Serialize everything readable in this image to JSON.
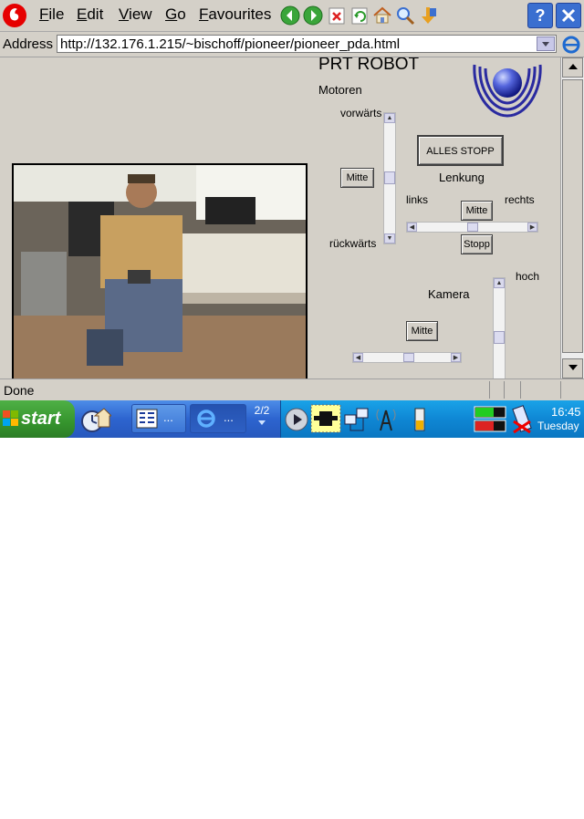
{
  "menubar": {
    "items": [
      {
        "key": "F",
        "rest": "ile"
      },
      {
        "key": "E",
        "rest": "dit"
      },
      {
        "key": "V",
        "rest": "iew"
      },
      {
        "key": "G",
        "rest": "o"
      },
      {
        "key": "F",
        "rest": "avourites"
      }
    ],
    "toolbar_icons": [
      "back-icon",
      "forward-icon",
      "stop-icon",
      "refresh-icon",
      "home-icon",
      "search-icon",
      "favourites-icon"
    ],
    "help_label": "?"
  },
  "address": {
    "label": "Address",
    "url": "http://132.176.1.215/~bischoff/pioneer/pioneer_pda.html"
  },
  "page": {
    "title": "PRT ROBOT",
    "motoren_label": "Motoren",
    "forward_label": "vorwärts",
    "backward_label": "rückwärts",
    "motor_mitte": "Mitte",
    "alles_stopp": "ALLES STOPP",
    "lenkung_label": "Lenkung",
    "links_label": "links",
    "rechts_label": "rechts",
    "lenkung_mitte": "Mitte",
    "stopp": "Stopp",
    "hoch_label": "hoch",
    "kamera_label": "Kamera",
    "kamera_mitte": "Mitte"
  },
  "status": {
    "text": "Done"
  },
  "taskbar": {
    "start_label": "start",
    "task1_ellipsis": "...",
    "task2_ellipsis": "...",
    "pager": "2/2",
    "battery": "60%",
    "time": "16:45",
    "day": "Tuesday"
  },
  "colors": {
    "page_bg": "#d4d0c8",
    "taskbar": "#2d64cf",
    "tray": "#0f87d4",
    "start": "#35942d",
    "logo_blue": "#2a2aa0"
  }
}
